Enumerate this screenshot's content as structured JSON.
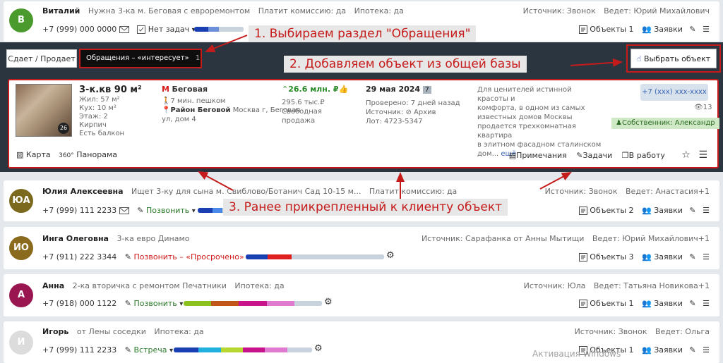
{
  "clients": [
    {
      "initials": "В",
      "avatar_color": "#4a9a2e",
      "name": "Виталий",
      "request": "Нужна 3-ка м. Беговая с евроремонтом",
      "commission": "Платит комиссию: да",
      "mortgage": "Ипотека: да",
      "source": "Источник: Звонок",
      "agent": "Ведет: Юрий Михайлович",
      "phone": "+7 (999) 000 0000",
      "task": "Нет задач",
      "objects": "Объекты 1",
      "requests": "Заявки"
    },
    {
      "initials": "ЮА",
      "avatar_color": "#7b6a1e",
      "name": "Юлия Алексеевна",
      "request": "Ищет 3-ку для сына м. Свиблово/Ботанич Сад 10-15 м...",
      "commission": "Платит комиссию: да",
      "source": "Источник: Звонок",
      "agent": "Ведет: Анастасия+1",
      "phone": "+7 (999) 111 2233",
      "task": "Позвонить",
      "objects": "Объекты 2",
      "requests": "Заявки"
    },
    {
      "initials": "ИО",
      "avatar_color": "#8a6a1c",
      "name": "Инга Олеговна",
      "request": "3-ка евро Динамо",
      "source": "Источник: Сарафанка от Анны Мытищи",
      "agent": "Ведет: Юрий Михайлович+1",
      "phone": "+7 (911) 222 3344",
      "task": "Позвонить – «Просрочено»",
      "objects": "Объекты 3",
      "requests": "Заявки"
    },
    {
      "initials": "А",
      "avatar_color": "#9a1650",
      "name": "Анна",
      "request": "2-ка вторичка с ремонтом Печатники",
      "mortgage": "Ипотека: да",
      "source": "Источник: Юла",
      "agent": "Ведет: Татьяна Новикова+1",
      "phone": "+7 (918) 000 1122",
      "task": "Позвонить",
      "objects": "Объекты 1",
      "requests": "Заявки"
    },
    {
      "initials": "И",
      "avatar_color": "#dcdcdc",
      "name": "Игорь",
      "request": "от Лены соседки",
      "mortgage": "Ипотека: да",
      "source": "Источник: Звонок",
      "agent": "Ведет: Ольга",
      "phone": "+7 (999) 111 2233",
      "task": "Встреча",
      "objects": "Объекты 1",
      "requests": "Заявки"
    }
  ],
  "tabs": {
    "sell": "Сдает / Продает",
    "requests": "Обращения – «интересует»",
    "requests_count": "1",
    "select_button": "Выбрать объект"
  },
  "object": {
    "title": "3-к.кв 90 м²",
    "photo_count": "26",
    "living": "Жил: 57 м²",
    "kitchen": "Кух: 10 м²",
    "floor": "Этаж: 2",
    "material": "Кирпич",
    "balcony": "Есть балкон",
    "metro": "Беговая",
    "walk": "7 мин. пешком",
    "district": "Район Беговой",
    "address_rest": " Москва г, Беговая",
    "address_line2": "ул, дом 4",
    "price": "26.6 млн. ₽",
    "price_per_m": "295.6 тыс.₽",
    "sale_type": "Свободная",
    "sale_type2": "продажа",
    "date": "29 мая 2024",
    "date_badge": "7",
    "checked": "Проверено: 7 дней назад",
    "source": "Источник:",
    "source_val": "Архив",
    "lot": "Лот: 4723-5347",
    "desc1": "Для ценителей истинной красоты и",
    "desc2": "комфорта, в одном из самых",
    "desc3": "известных домов Москвы",
    "desc4": "продается трехкомнатная квартира",
    "desc5": "в элитном фасадном сталинском",
    "desc6": "дом...",
    "desc_more": "ещё",
    "phone": "+7 (ххх) ххх-хххх",
    "views": "13",
    "owner": "Собственник: Александр",
    "map": "Карта",
    "panorama": "Панорама",
    "notes": "Примечания",
    "tasks": "Задачи",
    "to_work": "В работу"
  },
  "annotations": {
    "a1": "1. Выбираем раздел \"Обращения\"",
    "a2": "2. Добавляем объект из общей базы",
    "a3": "3. Ранее прикрепленный к клиенту объект"
  },
  "watermark": "Активация Windows",
  "bars": [
    {
      "segments": [
        {
          "color": "#1a3fb3",
          "value": 0.28
        },
        {
          "color": "#6b8fd8",
          "value": 0.22
        },
        {
          "color": "#c8d3de",
          "value": 0.5
        }
      ]
    },
    {
      "segments": [
        {
          "color": "#1a3fb3",
          "value": 0.3
        },
        {
          "color": "#4a89e8",
          "value": 0.2
        },
        {
          "color": "#c8d3de",
          "value": 0.5
        }
      ]
    },
    {
      "segments": [
        {
          "color": "#1a3fb3",
          "value": 0.16
        },
        {
          "color": "#e02020",
          "value": 0.17
        },
        {
          "color": "#c8d3de",
          "value": 0.67
        }
      ]
    },
    {
      "segments": [
        {
          "color": "#8cc21e",
          "value": 0.2
        },
        {
          "color": "#c0561a",
          "value": 0.2
        },
        {
          "color": "#c8148c",
          "value": 0.2
        },
        {
          "color": "#e07ad0",
          "value": 0.2
        },
        {
          "color": "#c8d3de",
          "value": 0.2
        }
      ]
    },
    {
      "segments": [
        {
          "color": "#1a3fb3",
          "value": 0.18
        },
        {
          "color": "#22b0e0",
          "value": 0.16
        },
        {
          "color": "#b8d630",
          "value": 0.16
        },
        {
          "color": "#c8148c",
          "value": 0.16
        },
        {
          "color": "#e07ad0",
          "value": 0.16
        },
        {
          "color": "#c8d3de",
          "value": 0.18
        }
      ]
    }
  ]
}
